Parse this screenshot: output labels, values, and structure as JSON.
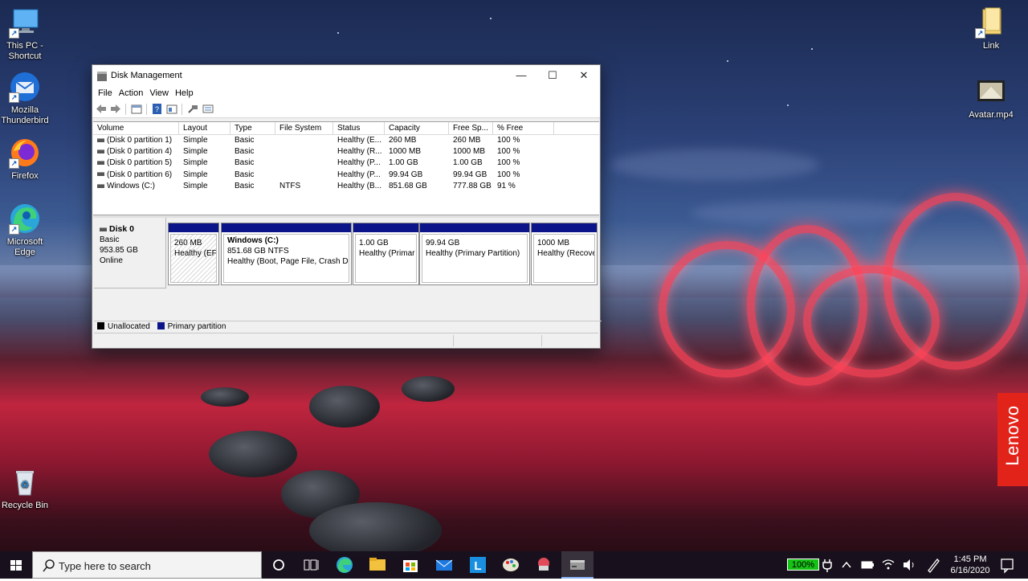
{
  "desktop": {
    "icons_left": [
      {
        "label": "This PC - Shortcut"
      },
      {
        "label": "Mozilla Thunderbird"
      },
      {
        "label": "Firefox"
      },
      {
        "label": "Microsoft Edge"
      },
      {
        "label": "Recycle Bin"
      }
    ],
    "icons_right": [
      {
        "label": "Link"
      },
      {
        "label": "Avatar.mp4"
      }
    ],
    "brand": "Lenovo"
  },
  "window": {
    "title": "Disk Management",
    "controls": {
      "minimize": "—",
      "maximize": "☐",
      "close": "✕"
    },
    "menu": [
      "File",
      "Action",
      "View",
      "Help"
    ],
    "volume_columns": [
      "Volume",
      "Layout",
      "Type",
      "File System",
      "Status",
      "Capacity",
      "Free Sp...",
      "% Free"
    ],
    "volumes": [
      {
        "volume": "(Disk 0 partition 1)",
        "layout": "Simple",
        "type": "Basic",
        "fs": "",
        "status": "Healthy (E...",
        "capacity": "260 MB",
        "free": "260 MB",
        "pct": "100 %"
      },
      {
        "volume": "(Disk 0 partition 4)",
        "layout": "Simple",
        "type": "Basic",
        "fs": "",
        "status": "Healthy (R...",
        "capacity": "1000 MB",
        "free": "1000 MB",
        "pct": "100 %"
      },
      {
        "volume": "(Disk 0 partition 5)",
        "layout": "Simple",
        "type": "Basic",
        "fs": "",
        "status": "Healthy (P...",
        "capacity": "1.00 GB",
        "free": "1.00 GB",
        "pct": "100 %"
      },
      {
        "volume": "(Disk 0 partition 6)",
        "layout": "Simple",
        "type": "Basic",
        "fs": "",
        "status": "Healthy (P...",
        "capacity": "99.94 GB",
        "free": "99.94 GB",
        "pct": "100 %"
      },
      {
        "volume": "Windows (C:)",
        "layout": "Simple",
        "type": "Basic",
        "fs": "NTFS",
        "status": "Healthy (B...",
        "capacity": "851.68 GB",
        "free": "777.88 GB",
        "pct": "91 %"
      }
    ],
    "disk": {
      "name": "Disk 0",
      "type": "Basic",
      "size": "953.85 GB",
      "state": "Online"
    },
    "partitions": [
      {
        "title": "",
        "line1": "260 MB",
        "line2": "Healthy (EFI"
      },
      {
        "title": "Windows  (C:)",
        "line1": "851.68 GB NTFS",
        "line2": "Healthy (Boot, Page File, Crash Du"
      },
      {
        "title": "",
        "line1": "1.00 GB",
        "line2": "Healthy (Primar"
      },
      {
        "title": "",
        "line1": "99.94 GB",
        "line2": "Healthy (Primary Partition)"
      },
      {
        "title": "",
        "line1": "1000 MB",
        "line2": "Healthy (Recove"
      }
    ],
    "legend": [
      {
        "label": "Unallocated",
        "color": "#000000"
      },
      {
        "label": "Primary partition",
        "color": "#0b1489"
      }
    ]
  },
  "taskbar": {
    "search_placeholder": "Type here to search",
    "battery": "100%",
    "time": "1:45 PM",
    "date": "6/16/2020",
    "accent": "#8ab4f8"
  }
}
